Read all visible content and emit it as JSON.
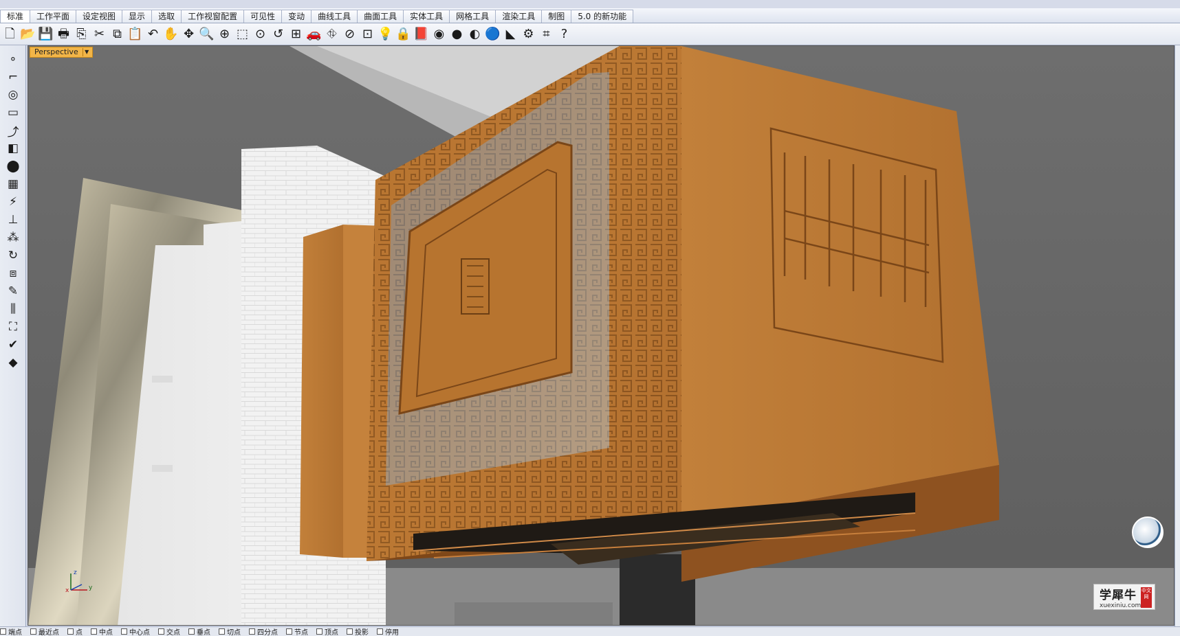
{
  "tabs": [
    {
      "label": "标准"
    },
    {
      "label": "工作平面"
    },
    {
      "label": "设定视图"
    },
    {
      "label": "显示"
    },
    {
      "label": "选取"
    },
    {
      "label": "工作视窗配置"
    },
    {
      "label": "可见性"
    },
    {
      "label": "变动"
    },
    {
      "label": "曲线工具"
    },
    {
      "label": "曲面工具"
    },
    {
      "label": "实体工具"
    },
    {
      "label": "网格工具"
    },
    {
      "label": "渲染工具"
    },
    {
      "label": "制图"
    },
    {
      "label": "5.0 的新功能"
    }
  ],
  "toolbar_icons": [
    "new-file-icon",
    "open-file-icon",
    "save-icon",
    "print-icon",
    "import-icon",
    "cut-icon",
    "copy-icon",
    "paste-icon",
    "undo-icon",
    "pan-icon",
    "rotate-view-icon",
    "zoom-icon",
    "zoom-window-icon",
    "zoom-extents-icon",
    "zoom-selected-icon",
    "undo-view-icon",
    "four-viewports-icon",
    "car-icon",
    "layer-icon",
    "properties-icon",
    "snap-icon",
    "light-bulb-icon",
    "lock-icon",
    "book-icon",
    "color-wheel-icon",
    "sphere-shaded-icon",
    "sphere-render-icon",
    "sphere-blue-icon",
    "render-icon",
    "gear-icon",
    "options-icon",
    "help-icon"
  ],
  "toolbar_glyphs": [
    "🗋",
    "📂",
    "💾",
    "🖶",
    "⎘",
    "✂",
    "⧉",
    "📋",
    "↶",
    "✋",
    "✥",
    "🔍",
    "⊕",
    "⬚",
    "⊙",
    "↺",
    "⊞",
    "🚗",
    "⛗",
    "⊘",
    "⊡",
    "💡",
    "🔒",
    "📕",
    "◉",
    "●",
    "◐",
    "🔵",
    "◣",
    "⚙",
    "⌗",
    "?"
  ],
  "left_tools": [
    {
      "name": "point-icon",
      "glyph": "∘"
    },
    {
      "name": "polyline-icon",
      "glyph": "⌐"
    },
    {
      "name": "circle-icon",
      "glyph": "◎"
    },
    {
      "name": "rectangle-icon",
      "glyph": "▭"
    },
    {
      "name": "fillet-icon",
      "glyph": "⤴"
    },
    {
      "name": "surface-icon",
      "glyph": "◧"
    },
    {
      "name": "solid-icon",
      "glyph": "⬤"
    },
    {
      "name": "mesh-icon",
      "glyph": "▦"
    },
    {
      "name": "light-icon",
      "glyph": "⚡"
    },
    {
      "name": "dimension-icon",
      "glyph": "⊥"
    },
    {
      "name": "group-icon",
      "glyph": "⁂"
    },
    {
      "name": "transform-icon",
      "glyph": "↻"
    },
    {
      "name": "array-icon",
      "glyph": "⧈"
    },
    {
      "name": "edit-icon",
      "glyph": "✎"
    },
    {
      "name": "analyze-icon",
      "glyph": "⫼"
    },
    {
      "name": "block-icon",
      "glyph": "⛶"
    },
    {
      "name": "check-icon",
      "glyph": "✔"
    },
    {
      "name": "render-tool-icon",
      "glyph": "◆"
    }
  ],
  "viewport": {
    "label": "Perspective"
  },
  "status_snaps": [
    "端点",
    "最近点",
    "点",
    "中点",
    "中心点",
    "交点",
    "垂点",
    "切点",
    "四分点",
    "节点",
    "顶点",
    "投影",
    "停用"
  ],
  "axis": {
    "x": "x",
    "y": "y",
    "z": "z"
  },
  "watermark": {
    "cn": "学犀牛",
    "url": "xuexiniu.com",
    "badge": "中文网"
  },
  "colors": {
    "viewport_bg": "#6b6b6b",
    "label_bg": "#f2b548",
    "copper": "#b8742e"
  }
}
